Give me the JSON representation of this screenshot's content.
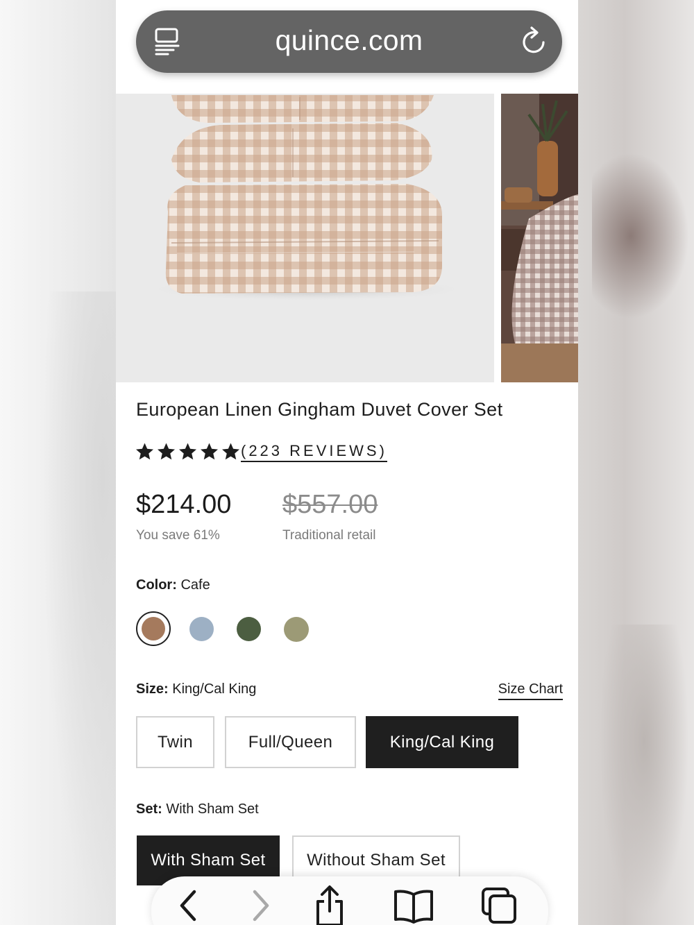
{
  "browser": {
    "domain": "quince.com",
    "reader_icon": "reader-mode-icon",
    "reload_icon": "reload-icon"
  },
  "product": {
    "title": "European Linen Gingham Duvet Cover Set",
    "rating": {
      "stars": 5,
      "reviews_label": "(223 REVIEWS)"
    },
    "price": "$214.00",
    "save_text": "You save 61%",
    "retail_price": "$557.00",
    "retail_label": "Traditional retail"
  },
  "color": {
    "label": "Color:",
    "value": "Cafe",
    "swatches": [
      "#a57a5d",
      "#9db0c4",
      "#4c5e41",
      "#9c9a76"
    ]
  },
  "size": {
    "label": "Size:",
    "value": "King/Cal King",
    "chart_link": "Size Chart",
    "options": [
      "Twin",
      "Full/Queen",
      "King/Cal King"
    ],
    "selected": "King/Cal King"
  },
  "set": {
    "label": "Set:",
    "value": "With Sham Set",
    "options": [
      "With Sham Set",
      "Without Sham Set"
    ],
    "selected": "With Sham Set"
  },
  "toolbar": {
    "icons": [
      "back-icon",
      "forward-icon",
      "share-icon",
      "bookmarks-icon",
      "tabs-icon"
    ]
  }
}
